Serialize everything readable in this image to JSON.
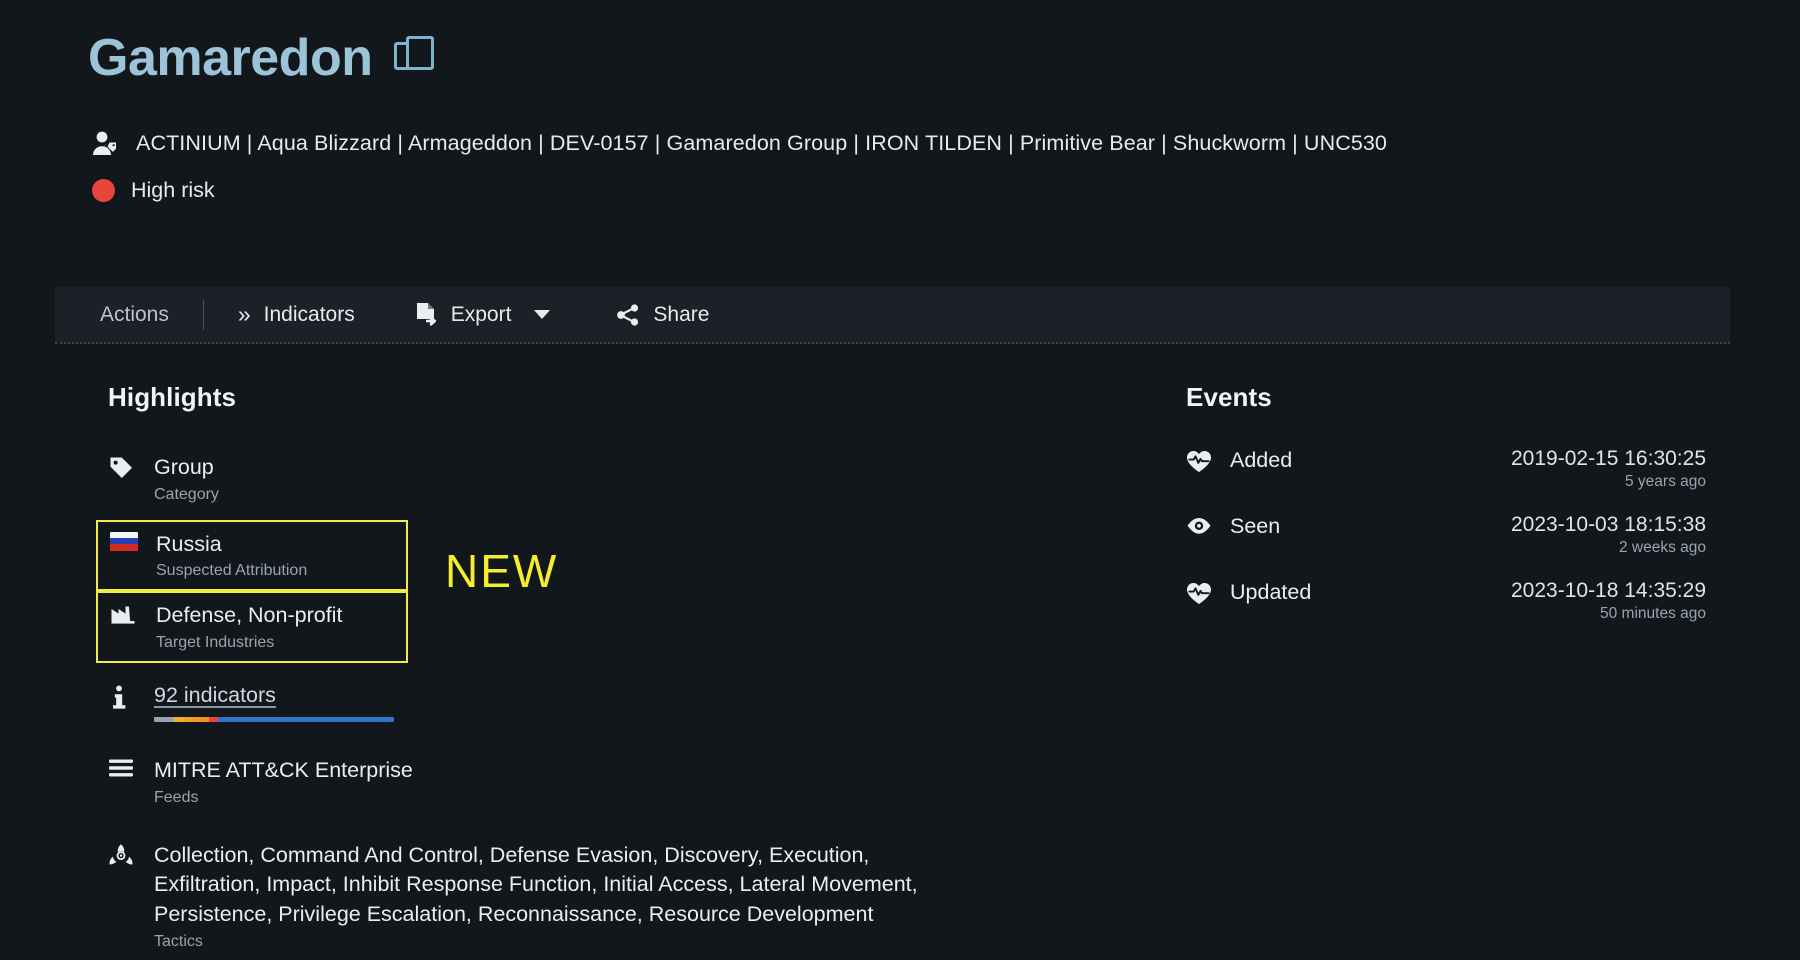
{
  "header": {
    "title": "Gamaredon",
    "copy_icon": "copy-icon",
    "aliases_icon": "person-tag-icon",
    "aliases": "ACTINIUM | Aqua Blizzard | Armageddon | DEV-0157 | Gamaredon Group | IRON TILDEN | Primitive Bear | Shuckworm | UNC530",
    "risk_icon": "risk-dot-icon",
    "risk_label": "High risk",
    "risk_color": "#e8453c",
    "title_color": "#9dc3d9"
  },
  "toolbar": {
    "actions_label": "Actions",
    "indicators_icon": "double-chevron-right-icon",
    "indicators_label": "Indicators",
    "export_icon": "export-document-icon",
    "export_label": "Export",
    "export_caret_icon": "chevron-down-icon",
    "share_icon": "share-icon",
    "share_label": "Share"
  },
  "highlights": {
    "title": "Highlights",
    "items": [
      {
        "icon": "tag-icon",
        "main": "Group",
        "sub": "Category",
        "highlighted": false
      },
      {
        "icon": "russia-flag-icon",
        "main": "Russia",
        "sub": "Suspected Attribution",
        "highlighted": true
      },
      {
        "icon": "factory-icon",
        "main": "Defense, Non-profit",
        "sub": "Target Industries",
        "highlighted": true
      },
      {
        "icon": "info-icon",
        "main": "92 indicators",
        "sub": "",
        "highlighted": false
      },
      {
        "icon": "list-icon",
        "main": "MITRE ATT&CK Enterprise",
        "sub": "Feeds",
        "highlighted": false
      },
      {
        "icon": "biohazard-icon",
        "main": "Collection, Command And Control, Defense Evasion, Discovery, Execution, Exfiltration, Impact, Inhibit Response Function, Initial Access, Lateral Movement, Persistence, Privilege Escalation, Reconnaissance, Resource Development",
        "sub": "Tactics",
        "highlighted": false
      }
    ]
  },
  "events": {
    "title": "Events",
    "rows": [
      {
        "icon": "heartbeat-icon",
        "label": "Added",
        "date": "2019-02-15 16:30:25",
        "relative": "5 years ago"
      },
      {
        "icon": "eye-icon",
        "label": "Seen",
        "date": "2023-10-03 18:15:38",
        "relative": "2 weeks ago"
      },
      {
        "icon": "heartbeat-icon",
        "label": "Updated",
        "date": "2023-10-18 14:35:29",
        "relative": "50 minutes ago"
      }
    ]
  },
  "annotation": {
    "new_label": "NEW",
    "new_color": "#f5ee2c",
    "box_border_color": "#f2ec4a"
  }
}
